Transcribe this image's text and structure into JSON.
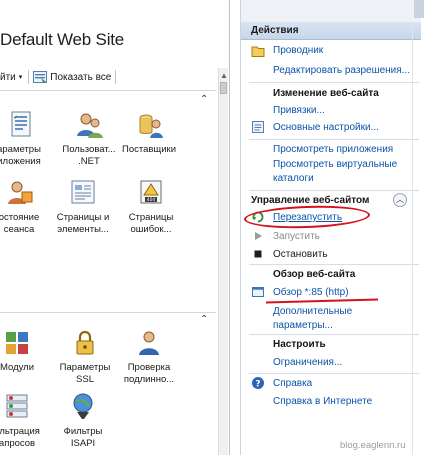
{
  "left_pane": {
    "title": "Default Web Site",
    "toolbar": {
      "fragment_label": "йти",
      "show_all_label": "Показать все"
    },
    "group1": {
      "features": [
        {
          "label_lines": [
            "араметры",
            "иложения"
          ],
          "icon": "app-settings-icon"
        },
        {
          "label_lines": [
            "Пользоват...",
            ".NET"
          ],
          "icon": "net-users-icon"
        },
        {
          "label_lines": [
            "Поставщики",
            ""
          ],
          "icon": "providers-icon"
        },
        {
          "label_lines": [
            "остояние",
            "сеанса"
          ],
          "icon": "session-state-icon"
        },
        {
          "label_lines": [
            "Страницы и",
            "элементы..."
          ],
          "icon": "pages-controls-icon"
        },
        {
          "label_lines": [
            "Страницы",
            "ошибок..."
          ],
          "icon": "error-pages-icon"
        }
      ]
    },
    "group2": {
      "features": [
        {
          "label_lines": [
            "Модули",
            ""
          ],
          "icon": "modules-icon"
        },
        {
          "label_lines": [
            "Параметры",
            "SSL"
          ],
          "icon": "ssl-settings-icon"
        },
        {
          "label_lines": [
            "Проверка",
            "подлинно..."
          ],
          "icon": "authentication-icon"
        },
        {
          "label_lines": [
            "ильтрация",
            "апросов"
          ],
          "icon": "request-filtering-icon"
        },
        {
          "label_lines": [
            "Фильтры",
            "ISAPI"
          ],
          "icon": "isapi-filters-icon"
        }
      ]
    }
  },
  "actions_pane": {
    "header": "Действия",
    "explore": "Проводник",
    "edit_permissions": "Редактировать разрешения...",
    "edit_site_head": "Изменение веб-сайта",
    "bindings": "Привязки...",
    "basic_settings": "Основные настройки...",
    "view_applications": "Просмотреть приложения",
    "view_virtual_dirs_line1": "Просмотреть виртуальные",
    "view_virtual_dirs_line2": "каталоги",
    "manage_site_head": "Управление веб-сайтом",
    "restart": "Перезапустить",
    "start": "Запустить",
    "stop": "Остановить",
    "browse_head": "Обзор веб-сайта",
    "browse_link": "Обзор *:85 (http)",
    "advanced_line1": "Дополнительные",
    "advanced_line2": "параметры...",
    "configure_head": "Настроить",
    "limits": "Ограничения...",
    "help": "Справка",
    "online_help": "Справка в Интернете"
  },
  "watermark": "blog.eaglenn.ru",
  "colors": {
    "link": "#0b55a8",
    "highlight": "#d4121b",
    "header_bg": "#c6d6ea"
  }
}
